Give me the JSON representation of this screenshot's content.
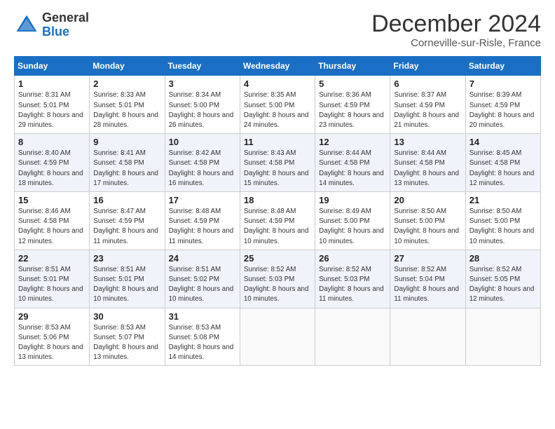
{
  "logo": {
    "general": "General",
    "blue": "Blue"
  },
  "header": {
    "month": "December 2024",
    "location": "Corneville-sur-Risle, France"
  },
  "weekdays": [
    "Sunday",
    "Monday",
    "Tuesday",
    "Wednesday",
    "Thursday",
    "Friday",
    "Saturday"
  ],
  "weeks": [
    [
      {
        "day": "1",
        "sunrise": "8:31 AM",
        "sunset": "5:01 PM",
        "daylight": "8 hours and 29 minutes."
      },
      {
        "day": "2",
        "sunrise": "8:33 AM",
        "sunset": "5:01 PM",
        "daylight": "8 hours and 28 minutes."
      },
      {
        "day": "3",
        "sunrise": "8:34 AM",
        "sunset": "5:00 PM",
        "daylight": "8 hours and 26 minutes."
      },
      {
        "day": "4",
        "sunrise": "8:35 AM",
        "sunset": "5:00 PM",
        "daylight": "8 hours and 24 minutes."
      },
      {
        "day": "5",
        "sunrise": "8:36 AM",
        "sunset": "4:59 PM",
        "daylight": "8 hours and 23 minutes."
      },
      {
        "day": "6",
        "sunrise": "8:37 AM",
        "sunset": "4:59 PM",
        "daylight": "8 hours and 21 minutes."
      },
      {
        "day": "7",
        "sunrise": "8:39 AM",
        "sunset": "4:59 PM",
        "daylight": "8 hours and 20 minutes."
      }
    ],
    [
      {
        "day": "8",
        "sunrise": "8:40 AM",
        "sunset": "4:59 PM",
        "daylight": "8 hours and 18 minutes."
      },
      {
        "day": "9",
        "sunrise": "8:41 AM",
        "sunset": "4:58 PM",
        "daylight": "8 hours and 17 minutes."
      },
      {
        "day": "10",
        "sunrise": "8:42 AM",
        "sunset": "4:58 PM",
        "daylight": "8 hours and 16 minutes."
      },
      {
        "day": "11",
        "sunrise": "8:43 AM",
        "sunset": "4:58 PM",
        "daylight": "8 hours and 15 minutes."
      },
      {
        "day": "12",
        "sunrise": "8:44 AM",
        "sunset": "4:58 PM",
        "daylight": "8 hours and 14 minutes."
      },
      {
        "day": "13",
        "sunrise": "8:44 AM",
        "sunset": "4:58 PM",
        "daylight": "8 hours and 13 minutes."
      },
      {
        "day": "14",
        "sunrise": "8:45 AM",
        "sunset": "4:58 PM",
        "daylight": "8 hours and 12 minutes."
      }
    ],
    [
      {
        "day": "15",
        "sunrise": "8:46 AM",
        "sunset": "4:58 PM",
        "daylight": "8 hours and 12 minutes."
      },
      {
        "day": "16",
        "sunrise": "8:47 AM",
        "sunset": "4:59 PM",
        "daylight": "8 hours and 11 minutes."
      },
      {
        "day": "17",
        "sunrise": "8:48 AM",
        "sunset": "4:59 PM",
        "daylight": "8 hours and 11 minutes."
      },
      {
        "day": "18",
        "sunrise": "8:48 AM",
        "sunset": "4:59 PM",
        "daylight": "8 hours and 10 minutes."
      },
      {
        "day": "19",
        "sunrise": "8:49 AM",
        "sunset": "5:00 PM",
        "daylight": "8 hours and 10 minutes."
      },
      {
        "day": "20",
        "sunrise": "8:50 AM",
        "sunset": "5:00 PM",
        "daylight": "8 hours and 10 minutes."
      },
      {
        "day": "21",
        "sunrise": "8:50 AM",
        "sunset": "5:00 PM",
        "daylight": "8 hours and 10 minutes."
      }
    ],
    [
      {
        "day": "22",
        "sunrise": "8:51 AM",
        "sunset": "5:01 PM",
        "daylight": "8 hours and 10 minutes."
      },
      {
        "day": "23",
        "sunrise": "8:51 AM",
        "sunset": "5:01 PM",
        "daylight": "8 hours and 10 minutes."
      },
      {
        "day": "24",
        "sunrise": "8:51 AM",
        "sunset": "5:02 PM",
        "daylight": "8 hours and 10 minutes."
      },
      {
        "day": "25",
        "sunrise": "8:52 AM",
        "sunset": "5:03 PM",
        "daylight": "8 hours and 10 minutes."
      },
      {
        "day": "26",
        "sunrise": "8:52 AM",
        "sunset": "5:03 PM",
        "daylight": "8 hours and 11 minutes."
      },
      {
        "day": "27",
        "sunrise": "8:52 AM",
        "sunset": "5:04 PM",
        "daylight": "8 hours and 11 minutes."
      },
      {
        "day": "28",
        "sunrise": "8:52 AM",
        "sunset": "5:05 PM",
        "daylight": "8 hours and 12 minutes."
      }
    ],
    [
      {
        "day": "29",
        "sunrise": "8:53 AM",
        "sunset": "5:06 PM",
        "daylight": "8 hours and 13 minutes."
      },
      {
        "day": "30",
        "sunrise": "8:53 AM",
        "sunset": "5:07 PM",
        "daylight": "8 hours and 13 minutes."
      },
      {
        "day": "31",
        "sunrise": "8:53 AM",
        "sunset": "5:08 PM",
        "daylight": "8 hours and 14 minutes."
      },
      null,
      null,
      null,
      null
    ]
  ]
}
